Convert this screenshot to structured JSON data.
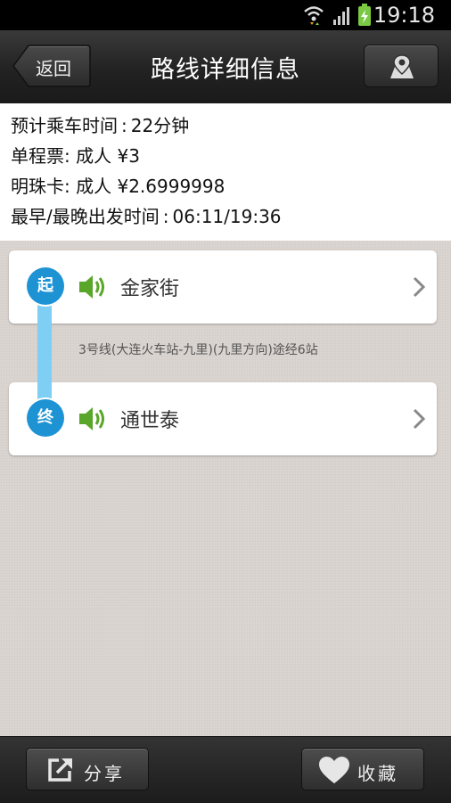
{
  "status_bar": {
    "time": "19:18"
  },
  "header": {
    "back_label": "返回",
    "title": "路线详细信息"
  },
  "info": {
    "ride_time_label": "预计乘车时间",
    "ride_time_value": "22分钟",
    "single_ticket_label": "单程票",
    "single_ticket_value": "成人 ¥3",
    "pearl_card_label": "明珠卡",
    "pearl_card_value": "成人 ¥2.6999998",
    "first_last_label": "最早/最晚出发时间",
    "first_last_value": "06:11/19:36"
  },
  "route": {
    "start_badge": "起",
    "start_station": "金家街",
    "segment_info": "3号线(大连火车站-九里)(九里方向)途经6站",
    "end_badge": "终",
    "end_station": "通世泰",
    "accent": "#1e93d4",
    "connector_color": "#7fcef3",
    "speaker_color": "#5aa62a"
  },
  "bottom_bar": {
    "share_label": "分享",
    "favorite_label": "收藏"
  }
}
